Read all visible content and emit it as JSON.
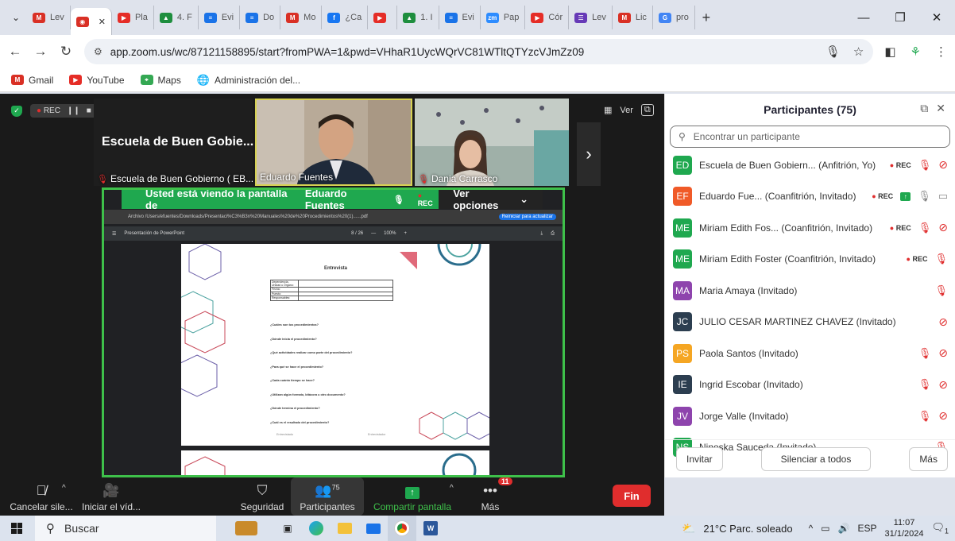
{
  "browser": {
    "tabs": [
      {
        "label": "Lev",
        "icon": "gmail",
        "color": "#d93025"
      },
      {
        "label": "",
        "icon": "zoom-record",
        "color": "#d93025",
        "active": true
      },
      {
        "label": "Pla",
        "icon": "youtube",
        "color": "#e52d27"
      },
      {
        "label": "4. F",
        "icon": "drive",
        "color": "#1e8e3e"
      },
      {
        "label": "Evi",
        "icon": "docs",
        "color": "#1a73e8"
      },
      {
        "label": "Do",
        "icon": "docs",
        "color": "#1a73e8"
      },
      {
        "label": "Mo",
        "icon": "gmail",
        "color": "#d93025"
      },
      {
        "label": "¿Ca",
        "icon": "facebook",
        "color": "#1877f2"
      },
      {
        "label": "",
        "icon": "youtube",
        "color": "#e52d27"
      },
      {
        "label": "1. I",
        "icon": "drive",
        "color": "#1e8e3e"
      },
      {
        "label": "Evi",
        "icon": "docs",
        "color": "#1a73e8"
      },
      {
        "label": "Pap",
        "icon": "zoom",
        "color": "#2d8cff"
      },
      {
        "label": "Cór",
        "icon": "youtube",
        "color": "#e52d27"
      },
      {
        "label": "Lev",
        "icon": "forms",
        "color": "#673ab7"
      },
      {
        "label": "Lic",
        "icon": "gmail",
        "color": "#d93025"
      },
      {
        "label": "pro",
        "icon": "google",
        "color": "#4285f4"
      }
    ],
    "url": "app.zoom.us/wc/87121158895/start?fromPWA=1&pwd=VHhaR1UycWQrVC81WTltQTYzcVJmZz09",
    "bookmarks": [
      "Gmail",
      "YouTube",
      "Maps",
      "Administración del..."
    ]
  },
  "meeting": {
    "rec_label": "REC",
    "host_title": "Escuela de Buen Gobie...",
    "tiles": [
      {
        "name": "Escuela de Buen Gobierno ( EB...",
        "muted": true
      },
      {
        "name": "Eduardo Fuentes",
        "muted": false
      },
      {
        "name": "Dania Carrasco",
        "muted": true
      }
    ],
    "view_label": "Ver",
    "banner": {
      "label": "Usted está viendo la pantalla de",
      "who": "Eduardo Fuentes",
      "rec": "REC",
      "options": "Ver opciones"
    },
    "pdf": {
      "url": "Archivo  /Users/efuentes/Downloads/Presentaci%C3%B3n%20Manuales%20de%20Procedimientos%20(1)......pdf",
      "reload": "Reiniciar para actualizar",
      "toolbar_title": "Presentación de PowerPoint",
      "page": "8 / 26",
      "zoom": "100%",
      "doc_title": "Entrevista",
      "table_rows": [
        "Dependencia, Unidad u Órgano:",
        "Fecha:",
        "Puesto:",
        "Responsables:"
      ],
      "questions": [
        "¿Cuáles son tus procedimientos?",
        "¿Dónde inicia el procedimiento?",
        "¿Qué actividades realizar como parte del procedimiento?",
        "¿Para qué se hace el procedimiento?",
        "¿Cada cuánto tiempo se hace?",
        "¿Utilizan algún formato, bitácora u otro documento?",
        "¿Dónde termina el procedimiento?",
        "¿Cuál es el resultado del procedimiento?"
      ],
      "signatures": [
        "Entrevistado",
        "Entrevistador"
      ]
    }
  },
  "toolbar": {
    "mute": "Cancelar sile...",
    "video": "Iniciar el víd...",
    "security": "Seguridad",
    "participants": "Participantes",
    "participants_count": "75",
    "share": "Compartir pantalla",
    "more": "Más",
    "more_badge": "11",
    "end": "Fin"
  },
  "panel": {
    "title": "Participantes (75)",
    "search_placeholder": "Encontrar un participante",
    "participants": [
      {
        "initials": "ED",
        "color": "#1fa84f",
        "name": "Escuela de Buen Gobiern... (Anfitrión, Yo)",
        "rec": true,
        "mic": "muted",
        "video": "off"
      },
      {
        "initials": "EF",
        "color": "#f05a28",
        "name": "Eduardo Fue... (Coanfitrión, Invitado)",
        "rec": true,
        "share": true,
        "mic": "on",
        "video": "on"
      },
      {
        "initials": "ME",
        "color": "#1fa84f",
        "name": "Miriam Edith Fos... (Coanfitrión, Invitado)",
        "rec": true,
        "mic": "muted",
        "video": "off"
      },
      {
        "initials": "ME",
        "color": "#1fa84f",
        "name": "Miriam Edith Foster (Coanfitrión, Invitado)",
        "rec": true,
        "mic": "muted",
        "video": "none"
      },
      {
        "initials": "MA",
        "color": "#8e44ad",
        "name": "Maria Amaya (Invitado)",
        "rec": false,
        "mic": "muted",
        "video": "none"
      },
      {
        "initials": "JC",
        "color": "#2c3e50",
        "name": "JULIO CESAR MARTINEZ CHAVEZ (Invitado)",
        "rec": false,
        "mic": "none",
        "video": "off"
      },
      {
        "initials": "PS",
        "color": "#f5a623",
        "name": "Paola Santos (Invitado)",
        "rec": false,
        "mic": "muted",
        "video": "off"
      },
      {
        "initials": "IE",
        "color": "#2c3e50",
        "name": "Ingrid Escobar (Invitado)",
        "rec": false,
        "mic": "muted",
        "video": "off"
      },
      {
        "initials": "JV",
        "color": "#8e44ad",
        "name": "Jorge Valle (Invitado)",
        "rec": false,
        "mic": "muted",
        "video": "off"
      },
      {
        "initials": "NS",
        "color": "#1fa84f",
        "name": "Ninoska Sauceda (Invitado)",
        "rec": false,
        "mic": "muted",
        "video": "none"
      }
    ],
    "rec_label": "REC",
    "invite": "Invitar",
    "mute_all": "Silenciar a todos",
    "more": "Más"
  },
  "taskbar": {
    "search": "Buscar",
    "weather": "21°C  Parc. soleado",
    "lang": "ESP",
    "time": "11:07",
    "date": "31/1/2024",
    "notif": "1"
  }
}
